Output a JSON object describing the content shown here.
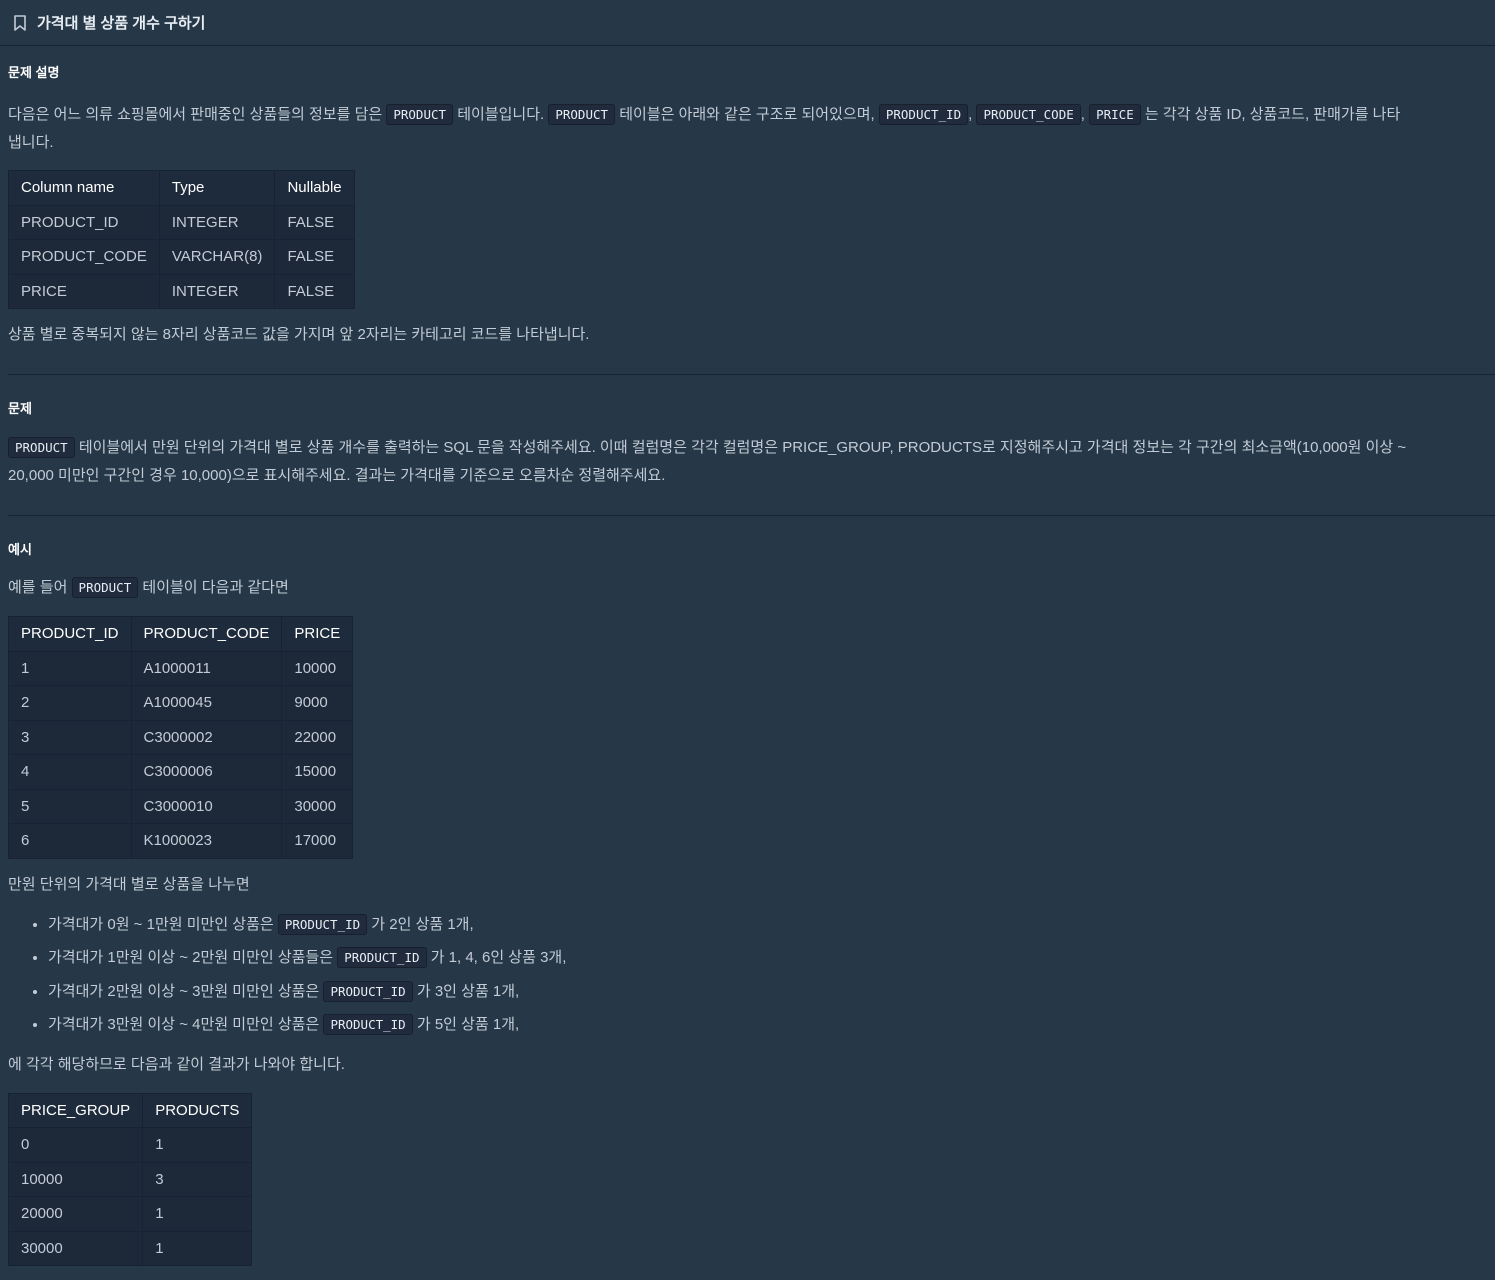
{
  "header": {
    "icon": "bookmark-icon",
    "title": "가격대 별 상품 개수 구하기"
  },
  "description": {
    "heading": "문제 설명",
    "p1": {
      "t1": "다음은 어느 의류 쇼핑몰에서 판매중인 상품들의 정보를 담은",
      "c1": "PRODUCT",
      "t2": "테이블입니다.",
      "c2": "PRODUCT",
      "t3": "테이블은 아래와 같은 구조로 되어있으며,",
      "c3": "PRODUCT_ID",
      "t4": ",",
      "c4": "PRODUCT_CODE",
      "t5": ",",
      "c5": "PRICE",
      "t6": "는 각각 상품 ID, 상품코드, 판매가를 나타",
      "t7": "냅니다."
    },
    "schema_table": {
      "headers": [
        "Column name",
        "Type",
        "Nullable"
      ],
      "rows": [
        [
          "PRODUCT_ID",
          "INTEGER",
          "FALSE"
        ],
        [
          "PRODUCT_CODE",
          "VARCHAR(8)",
          "FALSE"
        ],
        [
          "PRICE",
          "INTEGER",
          "FALSE"
        ]
      ]
    },
    "p2": "상품 별로 중복되지 않는 8자리 상품코드 값을 가지며 앞 2자리는 카테고리 코드를 나타냅니다."
  },
  "problem": {
    "heading": "문제",
    "c1": "PRODUCT",
    "t1": "테이블에서 만원 단위의 가격대 별로 상품 개수를 출력하는 SQL 문을 작성해주세요. 이때 컬럼명은 각각 컬럼명은 PRICE_GROUP, PRODUCTS로 지정해주시고 가격대 정보는 각 구간의 최소금액(10,000원 이상 ~",
    "t2": "20,000 미만인 구간인 경우 10,000)으로 표시해주세요. 결과는 가격대를 기준으로 오름차순 정렬해주세요."
  },
  "example": {
    "heading": "예시",
    "intro_t1": "예를 들어",
    "intro_c1": "PRODUCT",
    "intro_t2": "테이블이 다음과 같다면",
    "product_table": {
      "headers": [
        "PRODUCT_ID",
        "PRODUCT_CODE",
        "PRICE"
      ],
      "rows": [
        [
          "1",
          "A1000011",
          "10000"
        ],
        [
          "2",
          "A1000045",
          "9000"
        ],
        [
          "3",
          "C3000002",
          "22000"
        ],
        [
          "4",
          "C3000006",
          "15000"
        ],
        [
          "5",
          "C3000010",
          "30000"
        ],
        [
          "6",
          "K1000023",
          "17000"
        ]
      ]
    },
    "split_text": "만원 단위의 가격대 별로 상품을 나누면",
    "bullets": [
      {
        "pre": "가격대가 0원 ~ 1만원 미만인 상품은",
        "code": "PRODUCT_ID",
        "post": "가 2인 상품 1개,"
      },
      {
        "pre": "가격대가 1만원 이상 ~ 2만원 미만인 상품들은",
        "code": "PRODUCT_ID",
        "post": "가 1, 4, 6인 상품 3개,"
      },
      {
        "pre": "가격대가 2만원 이상 ~ 3만원 미만인 상품은",
        "code": "PRODUCT_ID",
        "post": "가 3인 상품 1개,"
      },
      {
        "pre": "가격대가 3만원 이상 ~ 4만원 미만인 상품은",
        "code": "PRODUCT_ID",
        "post": "가 5인 상품 1개,"
      }
    ],
    "result_text": "에 각각 해당하므로 다음과 같이 결과가 나와야 합니다.",
    "result_table": {
      "headers": [
        "PRICE_GROUP",
        "PRODUCTS"
      ],
      "rows": [
        [
          "0",
          "1"
        ],
        [
          "10000",
          "3"
        ],
        [
          "20000",
          "1"
        ],
        [
          "30000",
          "1"
        ]
      ]
    }
  }
}
